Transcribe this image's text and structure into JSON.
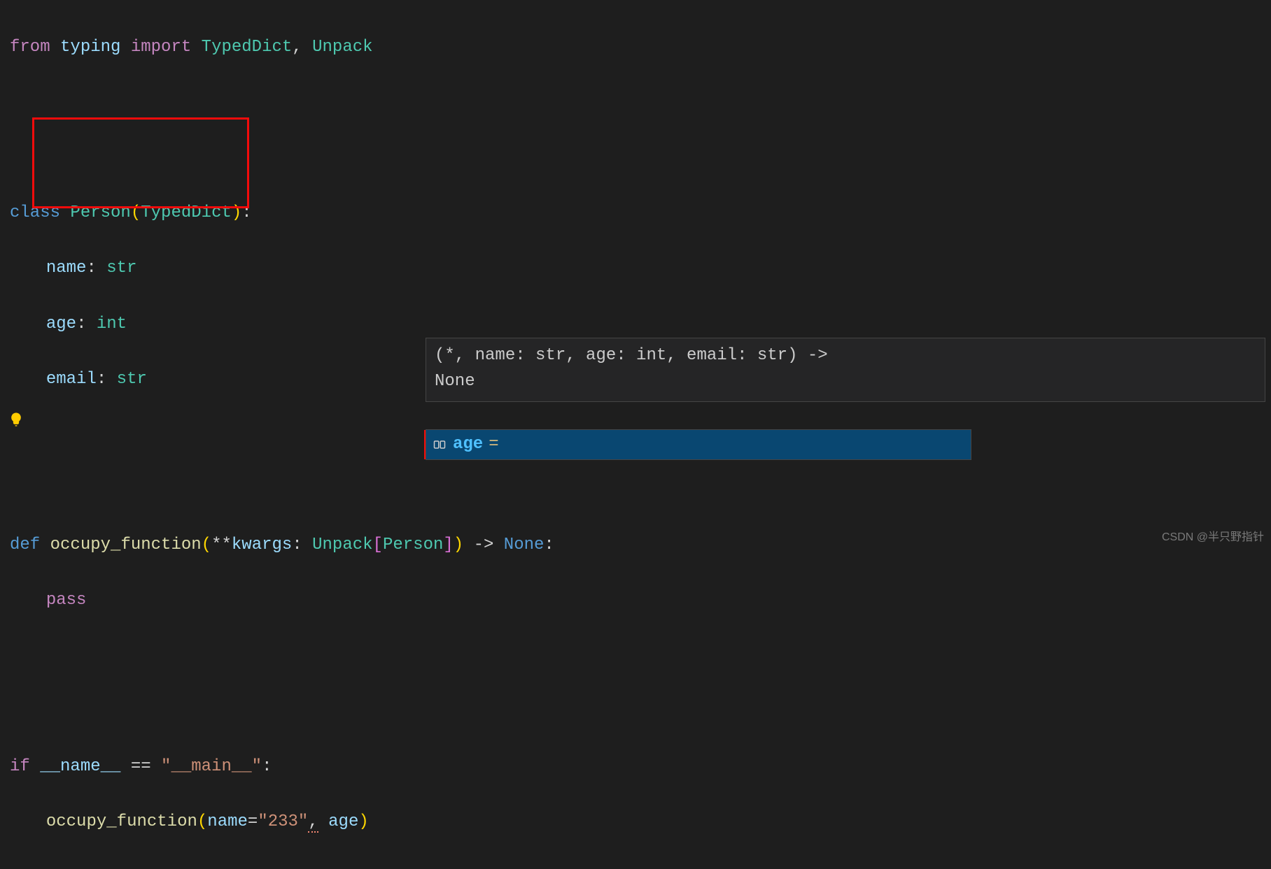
{
  "code": {
    "line1": {
      "kw_from": "from",
      "mod": "typing",
      "kw_import": "import",
      "item1": "TypedDict",
      "comma": ",",
      "item2": "Unpack"
    },
    "line3": {
      "kw_class": "class",
      "name": "Person",
      "lp": "(",
      "base": "TypedDict",
      "rp": ")",
      "colon": ":"
    },
    "line4": {
      "field": "name",
      "colon": ":",
      "type": "str"
    },
    "line5": {
      "field": "age",
      "colon": ":",
      "type": "int"
    },
    "line6": {
      "field": "email",
      "colon": ":",
      "type": "str"
    },
    "line8": {
      "kw_def": "def",
      "fname": "occupy_function",
      "lp": "(",
      "stars": "**",
      "kwargs": "kwargs",
      "colon": ":",
      "unpack": "Unpack",
      "lb": "[",
      "person": "Person",
      "rb": "]",
      "rp": ")",
      "arrow": " -> ",
      "none": "None",
      "colon2": ":"
    },
    "line9": {
      "pass": "pass"
    },
    "line11": {
      "kw_if": "if",
      "dunder": "__name__",
      "eq": " == ",
      "main": "\"__main__\"",
      "colon": ":"
    },
    "line12": {
      "call": "occupy_function",
      "lp": "(",
      "name_kw": "name",
      "eq1": "=",
      "val1": "\"233\"",
      "comma": ",",
      "age_kw": "age",
      "rp": ")"
    }
  },
  "signature": {
    "text": "(*, name: str, age: int, email: str) ->",
    "ret": "None"
  },
  "autocomplete": {
    "label": "age",
    "eq": "="
  },
  "watermark": "CSDN @半只野指针"
}
